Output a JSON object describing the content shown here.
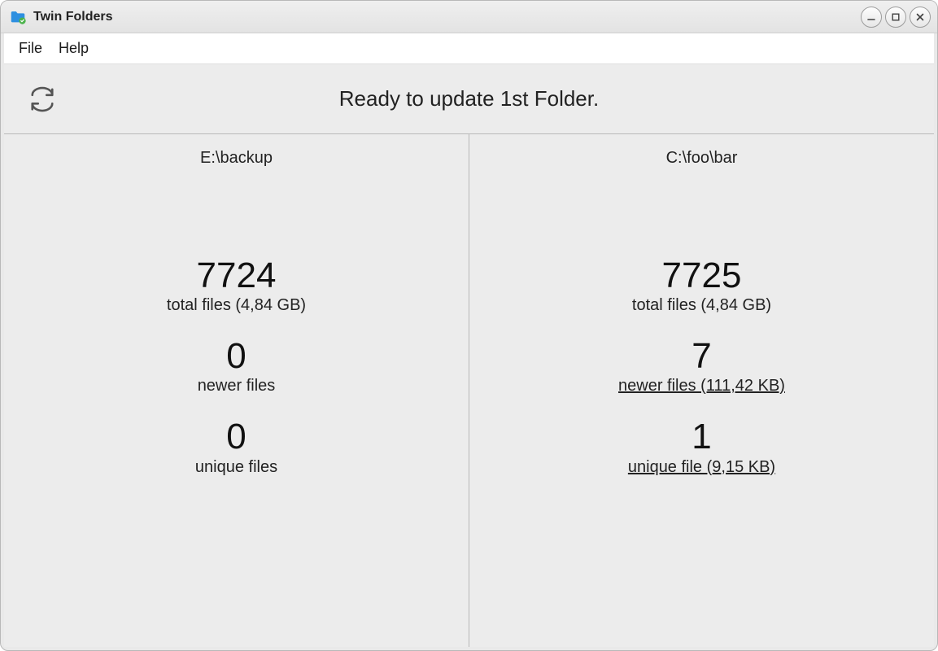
{
  "app": {
    "title": "Twin Folders"
  },
  "menu": {
    "file": "File",
    "help": "Help"
  },
  "status": {
    "message": "Ready to update 1st Folder."
  },
  "panes": {
    "left": {
      "path": "E:\\backup",
      "total_count": "7724",
      "total_label": "total files (4,84 GB)",
      "newer_count": "0",
      "newer_label": "newer files",
      "unique_count": "0",
      "unique_label": "unique files"
    },
    "right": {
      "path": "C:\\foo\\bar",
      "total_count": "7725",
      "total_label": "total files (4,84 GB)",
      "newer_count": "7",
      "newer_label": "newer files (111,42 KB)",
      "unique_count": "1",
      "unique_label": "unique file (9,15 KB)"
    }
  }
}
